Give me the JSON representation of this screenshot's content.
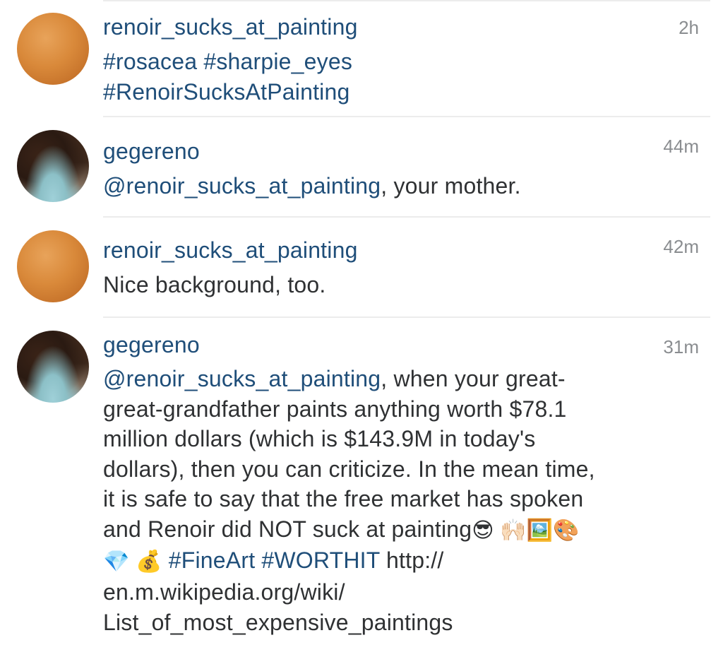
{
  "comments": [
    {
      "username": "renoir_sucks_at_painting",
      "time": "2h",
      "avatar": "orange-blurred-avatar",
      "tags_line1": "#rosacea #sharpie_eyes",
      "tags_line2": "#RenoirSucksAtPainting"
    },
    {
      "username": "gegereno",
      "time": "44m",
      "avatar": "dark-photo-avatar",
      "mention": "@renoir_sucks_at_painting",
      "text": ", your mother."
    },
    {
      "username": "renoir_sucks_at_painting",
      "time": "42m",
      "avatar": "orange-blurred-avatar",
      "text": "Nice background, too."
    },
    {
      "username": "gegereno",
      "time": "31m",
      "avatar": "dark-photo-avatar",
      "mention": "@renoir_sucks_at_painting",
      "line1_rest": ",  when your great-",
      "line2": "great-grandfather paints anything worth $78.1",
      "line3": "million dollars (which is $143.9M in today's",
      "line4": "dollars), then you can criticize. In the mean time,",
      "line5": "it is safe to say that the free market has spoken",
      "line6": "and Renoir did NOT suck at painting",
      "emoji_line6": "😎 🙌🏻🖼️🎨",
      "emoji_line7": "💎 💰",
      "hashtags": "#FineArt #WORTHIT",
      "url_part1": "http://",
      "url_part2": "en.m.wikipedia.org/wiki/",
      "url_part3": "List_of_most_expensive_paintings"
    }
  ],
  "colors": {
    "username": "#1f4e79",
    "text": "#2f3133",
    "time": "#8a8d90",
    "divider": "#ececec"
  }
}
